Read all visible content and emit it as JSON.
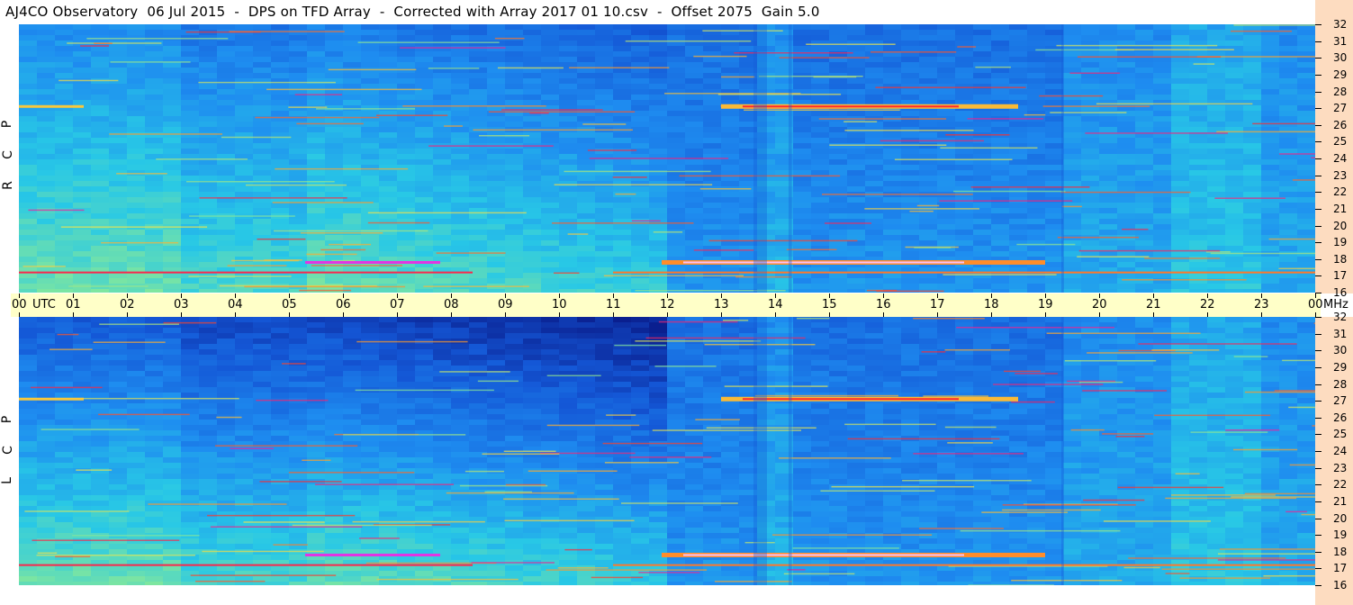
{
  "title": "AJ4CO Observatory  06 Jul 2015  -  DPS on TFD Array  -  Corrected with Array 2017 01 10.csv  -  Offset 2075  Gain 5.0",
  "time_axis": {
    "labels": [
      "00",
      "01",
      "02",
      "03",
      "04",
      "05",
      "06",
      "07",
      "08",
      "09",
      "10",
      "11",
      "12",
      "13",
      "14",
      "15",
      "16",
      "17",
      "18",
      "19",
      "20",
      "21",
      "22",
      "23",
      "00"
    ],
    "utc_label": "UTC",
    "unit_label": "MHz"
  },
  "colors": {
    "background": "#ffffff",
    "time_band": "#ffffc8",
    "mhz_strip": "#fddcc0",
    "colormap": [
      "#0a1f8f",
      "#1457d6",
      "#1e8cf0",
      "#28c8e6",
      "#7ee6a0",
      "#f2e64a",
      "#ff9a2a",
      "#ff2a2a",
      "#e01ee0",
      "#ffffff"
    ]
  },
  "chart_data": [
    {
      "type": "heatmap",
      "polarization": "RCP",
      "ylabel": "R C P",
      "xlabel": "UTC",
      "x_ticks": [
        "00",
        "01",
        "02",
        "03",
        "04",
        "05",
        "06",
        "07",
        "08",
        "09",
        "10",
        "11",
        "12",
        "13",
        "14",
        "15",
        "16",
        "17",
        "18",
        "19",
        "20",
        "21",
        "22",
        "23",
        "00"
      ],
      "xlim_hours": [
        0,
        24
      ],
      "y_unit": "MHz",
      "y_ticks": [
        32,
        31,
        30,
        29,
        28,
        27,
        26,
        25,
        24,
        23,
        22,
        21,
        20,
        19,
        18,
        17,
        16
      ],
      "ylim": [
        16,
        32
      ],
      "features": {
        "bright_bands_mhz": [
          17.2,
          17.8,
          27.1
        ],
        "band_27_1_hours": [
          13.0,
          18.5
        ],
        "band_17_8_hours": [
          11.9,
          19.0
        ],
        "quiet_until_hour": 5.3,
        "darker_after_hour": 19.3
      }
    },
    {
      "type": "heatmap",
      "polarization": "LCP",
      "ylabel": "L C P",
      "xlabel": "UTC",
      "x_ticks": [
        "00",
        "01",
        "02",
        "03",
        "04",
        "05",
        "06",
        "07",
        "08",
        "09",
        "10",
        "11",
        "12",
        "13",
        "14",
        "15",
        "16",
        "17",
        "18",
        "19",
        "20",
        "21",
        "22",
        "23",
        "00"
      ],
      "xlim_hours": [
        0,
        24
      ],
      "y_unit": "MHz",
      "y_ticks": [
        32,
        31,
        30,
        29,
        28,
        27,
        26,
        25,
        24,
        23,
        22,
        21,
        20,
        19,
        18,
        17,
        16
      ],
      "ylim": [
        16,
        32
      ],
      "features": {
        "bright_bands_mhz": [
          17.2,
          17.8,
          27.1
        ],
        "band_27_1_hours": [
          13.0,
          18.5
        ],
        "band_17_8_hours": [
          11.9,
          19.0
        ],
        "quiet_until_hour": 5.3,
        "darker_after_hour": 19.3
      }
    }
  ]
}
